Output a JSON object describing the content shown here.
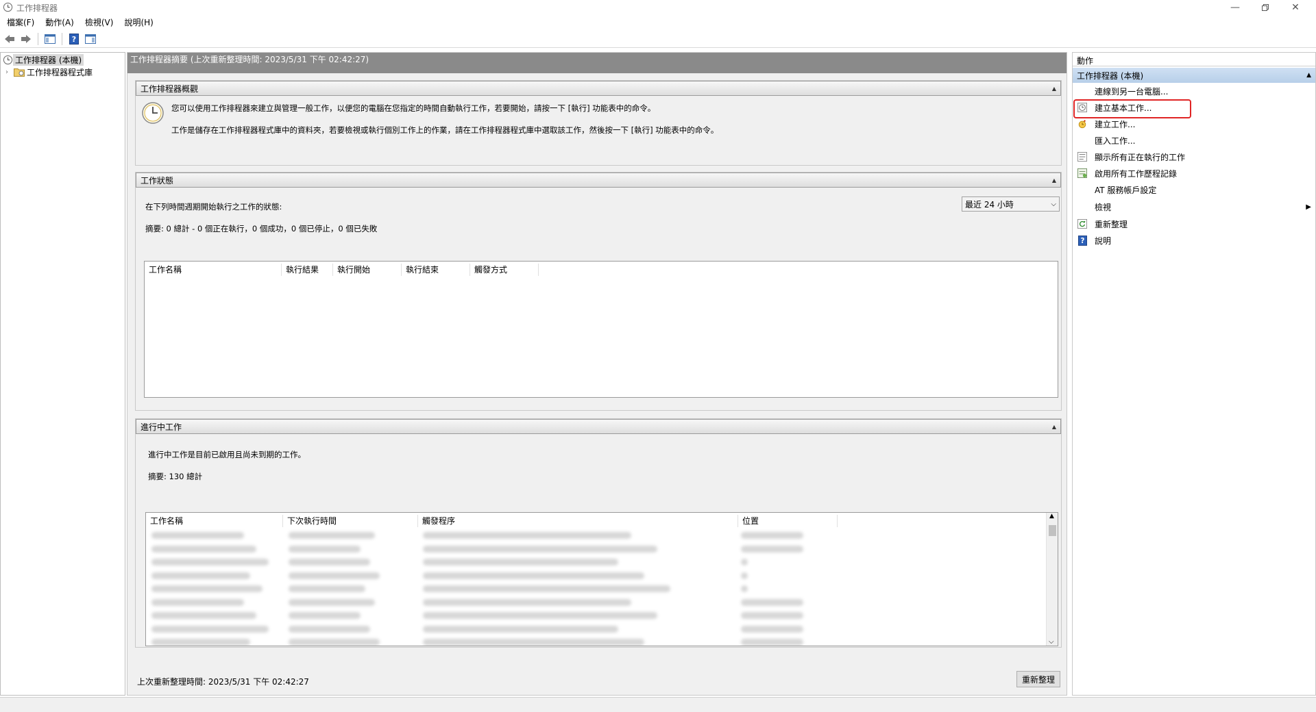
{
  "window": {
    "title": "工作排程器"
  },
  "menu": [
    "檔案(F)",
    "動作(A)",
    "檢視(V)",
    "說明(H)"
  ],
  "tree": {
    "root": "工作排程器 (本機)",
    "library": "工作排程器程式庫"
  },
  "header": {
    "title": "工作排程器摘要 (上次重新整理時間: 2023/5/31 下午 02:42:27)"
  },
  "overview": {
    "title": "工作排程器概觀",
    "line1": "您可以使用工作排程器來建立與管理一般工作，以便您的電腦在您指定的時間自動執行工作，若要開始，請按一下 [執行] 功能表中的命令。",
    "line2": "工作是儲存在工作排程器程式庫中的資料夾，若要檢視或執行個別工作上的作業，請在工作排程器程式庫中選取該工作，然後按一下 [執行] 功能表中的命令。"
  },
  "status": {
    "title": "工作狀態",
    "period_label": "在下列時間週期開始執行之工作的狀態:",
    "period_value": "最近 24 小時",
    "summary": "摘要: 0 總計 - 0 個正在執行，0 個成功，0 個已停止，0 個已失敗",
    "columns": [
      "工作名稱",
      "執行結果",
      "執行開始",
      "執行結束",
      "觸發方式"
    ]
  },
  "active": {
    "title": "進行中工作",
    "desc": "進行中工作是目前已啟用且尚未到期的工作。",
    "summary": "摘要: 130 總計",
    "columns": [
      "工作名稱",
      "下次執行時間",
      "觸發程序",
      "位置"
    ]
  },
  "footer": {
    "last_refresh": "上次重新整理時間: 2023/5/31 下午 02:42:27",
    "refresh_button": "重新整理"
  },
  "actions": {
    "title": "動作",
    "group": "工作排程器 (本機)",
    "items": [
      {
        "label": "連線到另一台電腦...",
        "icon": "none"
      },
      {
        "label": "建立基本工作...",
        "icon": "clock-wizard-icon"
      },
      {
        "label": "建立工作...",
        "icon": "new-task-icon"
      },
      {
        "label": "匯入工作...",
        "icon": "none"
      },
      {
        "label": "顯示所有正在執行的工作",
        "icon": "running-tasks-icon"
      },
      {
        "label": "啟用所有工作歷程記錄",
        "icon": "history-icon"
      },
      {
        "label": "AT 服務帳戶設定",
        "icon": "none"
      },
      {
        "label": "檢視",
        "icon": "none"
      },
      {
        "label": "重新整理",
        "icon": "refresh-icon"
      },
      {
        "label": "說明",
        "icon": "help-icon"
      }
    ]
  },
  "colors": {
    "accent_highlight": "#e02424",
    "header_bg": "#8a8a8a",
    "action_group_bg": "#c4d7ee"
  }
}
